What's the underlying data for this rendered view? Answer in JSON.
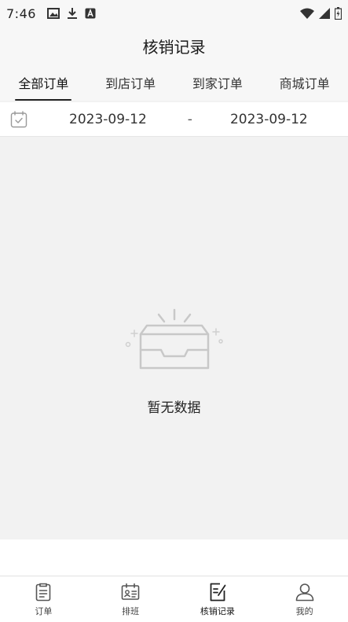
{
  "status_bar": {
    "time": "7:46",
    "left_icons": [
      "image-icon",
      "download-icon",
      "a-box-icon"
    ],
    "right_icons": [
      "wifi-icon",
      "signal-icon",
      "battery-icon"
    ]
  },
  "header": {
    "title": "核销记录"
  },
  "tabs": [
    {
      "label": "全部订单",
      "active": true
    },
    {
      "label": "到店订单",
      "active": false
    },
    {
      "label": "到家订单",
      "active": false
    },
    {
      "label": "商城订单",
      "active": false
    }
  ],
  "date_filter": {
    "icon": "calendar-icon",
    "start": "2023-09-12",
    "separator": "-",
    "end": "2023-09-12"
  },
  "empty_state": {
    "icon": "empty-box-icon",
    "text": "暂无数据"
  },
  "tabbar": [
    {
      "label": "订单",
      "icon": "clipboard-icon",
      "active": false
    },
    {
      "label": "排班",
      "icon": "schedule-icon",
      "active": false
    },
    {
      "label": "核销记录",
      "icon": "edit-note-icon",
      "active": true
    },
    {
      "label": "我的",
      "icon": "user-icon",
      "active": false
    }
  ],
  "colors": {
    "background": "#f2f2f2",
    "surface": "#ffffff",
    "text": "#222222",
    "muted_icon": "#c8c8c8"
  }
}
